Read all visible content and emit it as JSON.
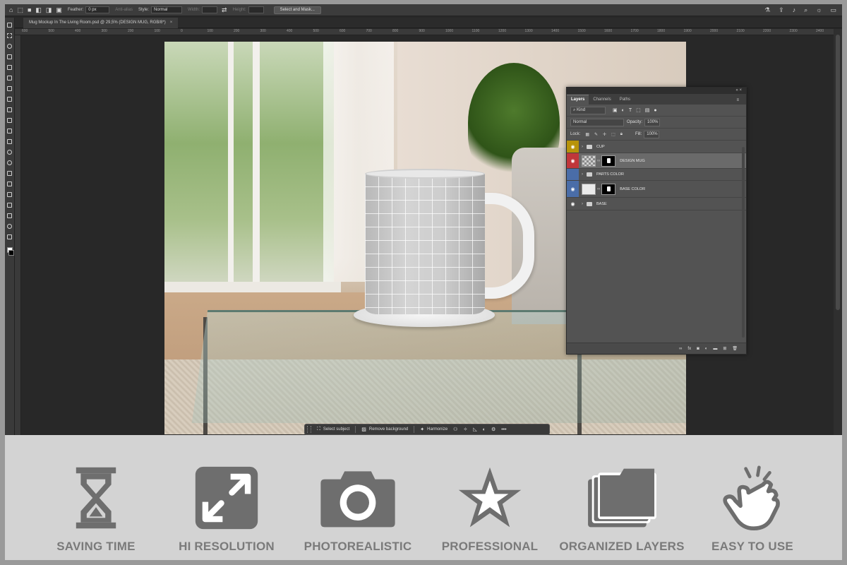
{
  "options_bar": {
    "feather_label": "Feather:",
    "feather_value": "0 px",
    "anti_alias_label": "Anti-alias",
    "style_label": "Style:",
    "style_value": "Normal",
    "width_label": "Width:",
    "height_label": "Height:",
    "select_mask_label": "Select and Mask..."
  },
  "document_tab": {
    "title": "Mug Mockup In The Living Room.psd @ 29,5% (DESIGN MUG, RGB/8*)",
    "close": "×"
  },
  "ruler_ticks": [
    "600",
    "500",
    "400",
    "300",
    "200",
    "100",
    "0",
    "100",
    "200",
    "300",
    "400",
    "500",
    "600",
    "700",
    "800",
    "900",
    "1000",
    "1100",
    "1200",
    "1300",
    "1400",
    "1500",
    "1600",
    "1700",
    "1800",
    "1900",
    "2000",
    "2100",
    "2200",
    "2300",
    "2400"
  ],
  "context_bar": {
    "select_subject": "Select subject",
    "remove_background": "Remove background",
    "harmonize": "Harmonize",
    "more": "•••"
  },
  "layers_panel": {
    "tabs": [
      "Layers",
      "Channels",
      "Paths"
    ],
    "kind_label": "Kind",
    "blend_mode": "Normal",
    "opacity_label": "Opacity:",
    "opacity_value": "100%",
    "lock_label": "Lock:",
    "fill_label": "Fill:",
    "fill_value": "100%",
    "layers": [
      {
        "name": "CUP",
        "type": "group",
        "eye_color": "#b8930a"
      },
      {
        "name": "DESIGN MUG",
        "type": "smart",
        "eye_color": "#c0363a",
        "active": true
      },
      {
        "name": "PARTS COLOR",
        "type": "group",
        "eye_color": "#4a6da8",
        "hidden": true
      },
      {
        "name": "BASE COLOR",
        "type": "fill",
        "eye_color": "#4a6da8"
      },
      {
        "name": "BASE",
        "type": "group",
        "eye_color": "#535353"
      }
    ]
  },
  "features": [
    {
      "label": "SAVING TIME",
      "icon": "hourglass-icon"
    },
    {
      "label": "HI RESOLUTION",
      "icon": "expand-icon"
    },
    {
      "label": "PHOTOREALISTIC",
      "icon": "camera-icon"
    },
    {
      "label": "PROFESSIONAL",
      "icon": "star-icon"
    },
    {
      "label": "ORGANIZED LAYERS",
      "icon": "layers-icon"
    },
    {
      "label": "EASY TO USE",
      "icon": "hand-tap-icon"
    }
  ],
  "colors": {
    "feature_icon": "#6e6e6e",
    "feature_text": "#7a7a7a",
    "workspace": "#282828",
    "panel": "#535353"
  }
}
